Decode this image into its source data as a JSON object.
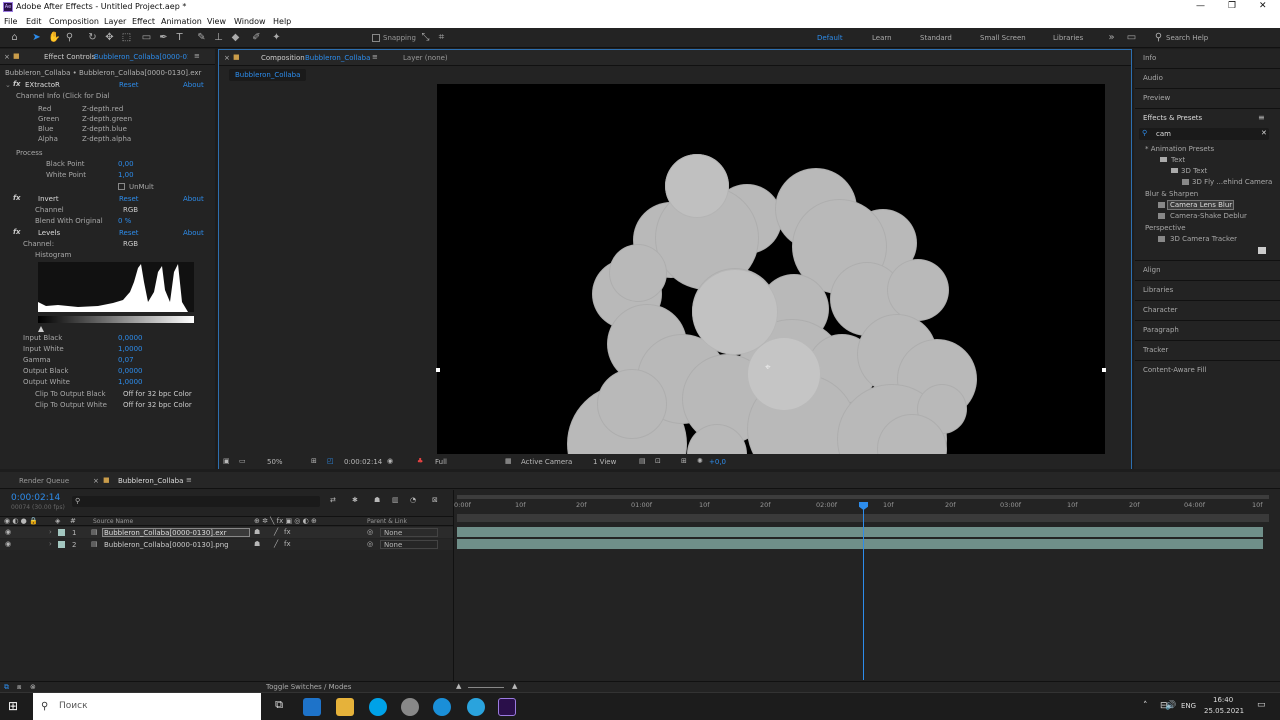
{
  "window": {
    "title": "Adobe After Effects - Untitled Project.aep *",
    "controls": [
      "—",
      "❐",
      "✕"
    ]
  },
  "menu": [
    "File",
    "Edit",
    "Composition",
    "Layer",
    "Effect",
    "Animation",
    "View",
    "Window",
    "Help"
  ],
  "toolbar": {
    "snapping": "Snapping",
    "workspaces": [
      "Default",
      "Learn",
      "Standard",
      "Small Screen",
      "Libraries"
    ],
    "search_help": "Search Help"
  },
  "effect_controls": {
    "tab_label": "Effect Controls",
    "tab_layer": "Bubbleron_Collaba[0000-013",
    "breadcrumb": "Bubbleron_Collaba • Bubbleron_Collaba[0000-0130].exr",
    "extractor": {
      "name": "EXtractoR",
      "reset": "Reset",
      "about": "About",
      "channel_info": "Channel Info (Click for Dial",
      "channels": [
        {
          "label": "Red",
          "value": "Z-depth.red"
        },
        {
          "label": "Green",
          "value": "Z-depth.green"
        },
        {
          "label": "Blue",
          "value": "Z-depth.blue"
        },
        {
          "label": "Alpha",
          "value": "Z-depth.alpha"
        }
      ],
      "process": "Process",
      "black_point": {
        "label": "Black Point",
        "value": "0,00"
      },
      "white_point": {
        "label": "White Point",
        "value": "1,00"
      },
      "unmult": "UnMult"
    },
    "invert": {
      "name": "Invert",
      "reset": "Reset",
      "about": "About",
      "channel": {
        "label": "Channel",
        "value": "RGB"
      },
      "blend": {
        "label": "Blend With Original",
        "value": "0 %"
      }
    },
    "levels": {
      "name": "Levels",
      "reset": "Reset",
      "about": "About",
      "channel": {
        "label": "Channel:",
        "value": "RGB"
      },
      "histogram": "Histogram",
      "props": [
        {
          "label": "Input Black",
          "value": "0,0000"
        },
        {
          "label": "Input White",
          "value": "1,0000"
        },
        {
          "label": "Gamma",
          "value": "0,07"
        },
        {
          "label": "Output Black",
          "value": "0,0000"
        },
        {
          "label": "Output White",
          "value": "1,0000"
        }
      ],
      "clip_black": {
        "label": "Clip To Output Black",
        "value": "Off for 32 bpc Color"
      },
      "clip_white": {
        "label": "Clip To Output White",
        "value": "Off for 32 bpc Color"
      }
    }
  },
  "composition": {
    "tab_label": "Composition",
    "tab_name": "Bubbleron_Collaba",
    "layer_tab": "Layer (none)",
    "flow_tab": "Bubbleron_Collaba",
    "footer": {
      "zoom": "50%",
      "timecode": "0:00:02:14",
      "resolution": "Full",
      "camera": "Active Camera",
      "views": "1 View",
      "exposure": "+0,0"
    }
  },
  "right_panels": {
    "top": [
      "Info",
      "Audio",
      "Preview"
    ],
    "effects_presets": {
      "title": "Effects & Presets",
      "search": "cam",
      "tree": [
        {
          "text": "* Animation Presets",
          "level": 0,
          "selected": false
        },
        {
          "text": "Text",
          "level": 1,
          "selected": false
        },
        {
          "text": "3D Text",
          "level": 2,
          "selected": false
        },
        {
          "text": "3D Fly ...ehind Camera",
          "level": 3,
          "selected": false
        },
        {
          "text": "Blur & Sharpen",
          "level": 0,
          "selected": false
        },
        {
          "text": "Camera Lens Blur",
          "level": 1,
          "selected": true
        },
        {
          "text": "Camera-Shake Deblur",
          "level": 1,
          "selected": false
        },
        {
          "text": "Perspective",
          "level": 0,
          "selected": false
        },
        {
          "text": "3D Camera Tracker",
          "level": 1,
          "selected": false
        }
      ]
    },
    "bottom": [
      "Align",
      "Libraries",
      "Character",
      "Paragraph",
      "Tracker",
      "Content-Aware Fill"
    ]
  },
  "timeline": {
    "render_queue": "Render Queue",
    "comp_tab": "Bubbleron_Collaba",
    "timecode": "0:00:02:14",
    "frame_info": "00074 (30.00 fps)",
    "columns": {
      "source_name": "Source Name",
      "parent": "Parent & Link"
    },
    "layers": [
      {
        "num": "1",
        "name": "Bubbleron_Collaba[0000-0130].exr",
        "parent": "None"
      },
      {
        "num": "2",
        "name": "Bubbleron_Collaba[0000-0130].png",
        "parent": "None"
      }
    ],
    "ruler": [
      "0:00f",
      "10f",
      "20f",
      "01:00f",
      "10f",
      "20f",
      "02:00f",
      "10f",
      "20f",
      "03:00f",
      "10f",
      "20f",
      "04:00f",
      "10f"
    ],
    "toggle": "Toggle Switches / Modes",
    "playhead": 0.5
  },
  "taskbar": {
    "search": "Поиск",
    "lang": "ENG",
    "time": "16:40",
    "date": "25.05.2021"
  }
}
